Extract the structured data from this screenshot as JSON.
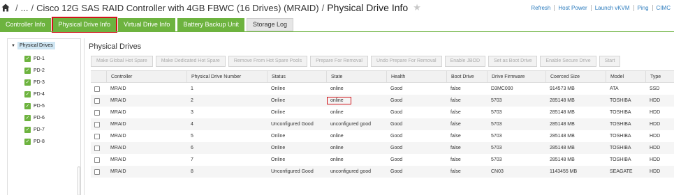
{
  "header": {
    "breadcrumb_ellipsis": "...",
    "breadcrumb_controller": "Cisco 12G SAS RAID Controller with 4GB FBWC (16 Drives) (MRAID)",
    "page_title": "Physical Drive Info",
    "links": [
      "Refresh",
      "Host Power",
      "Launch vKVM",
      "Ping",
      "CIMC"
    ]
  },
  "tabs": [
    "Controller Info",
    "Physical Drive Info",
    "Virtual Drive Info",
    "Battery Backup Unit",
    "Storage Log"
  ],
  "tree": {
    "root": "Physical Drives",
    "items": [
      "PD-1",
      "PD-2",
      "PD-3",
      "PD-4",
      "PD-5",
      "PD-6",
      "PD-7",
      "PD-8"
    ]
  },
  "main": {
    "title": "Physical Drives",
    "toolbar": [
      "Make Global Hot Spare",
      "Make Dedicated Hot Spare",
      "Remove From Hot Spare Pools",
      "Prepare For Removal",
      "Undo Prepare For Removal",
      "Enable JBOD",
      "Set as Boot Drive",
      "Enable Secure Drive",
      "Start"
    ],
    "columns": [
      "Controller",
      "Physical Drive Number",
      "Status",
      "State",
      "Health",
      "Boot Drive",
      "Drive Firmware",
      "Coerced Size",
      "Model",
      "Type"
    ],
    "rows": [
      [
        "MRAID",
        "1",
        "Online",
        "online",
        "Good",
        "false",
        "D3MC000",
        "914573 MB",
        "ATA",
        "SSD"
      ],
      [
        "MRAID",
        "2",
        "Online",
        "online",
        "Good",
        "false",
        "5703",
        "285148 MB",
        "TOSHIBA",
        "HDD"
      ],
      [
        "MRAID",
        "3",
        "Online",
        "online",
        "Good",
        "false",
        "5703",
        "285148 MB",
        "TOSHIBA",
        "HDD"
      ],
      [
        "MRAID",
        "4",
        "Unconfigured Good",
        "unconfigured good",
        "Good",
        "false",
        "5703",
        "285148 MB",
        "TOSHIBA",
        "HDD"
      ],
      [
        "MRAID",
        "5",
        "Online",
        "online",
        "Good",
        "false",
        "5703",
        "285148 MB",
        "TOSHIBA",
        "HDD"
      ],
      [
        "MRAID",
        "6",
        "Online",
        "online",
        "Good",
        "false",
        "5703",
        "285148 MB",
        "TOSHIBA",
        "HDD"
      ],
      [
        "MRAID",
        "7",
        "Online",
        "online",
        "Good",
        "false",
        "5703",
        "285148 MB",
        "TOSHIBA",
        "HDD"
      ],
      [
        "MRAID",
        "8",
        "Unconfigured Good",
        "unconfigured good",
        "Good",
        "false",
        "CN03",
        "1143455 MB",
        "SEAGATE",
        "HDD"
      ]
    ]
  },
  "colors": {
    "tab_green": "#6db33f",
    "highlight_red": "#d0141a",
    "link_blue": "#2b7bbd"
  }
}
